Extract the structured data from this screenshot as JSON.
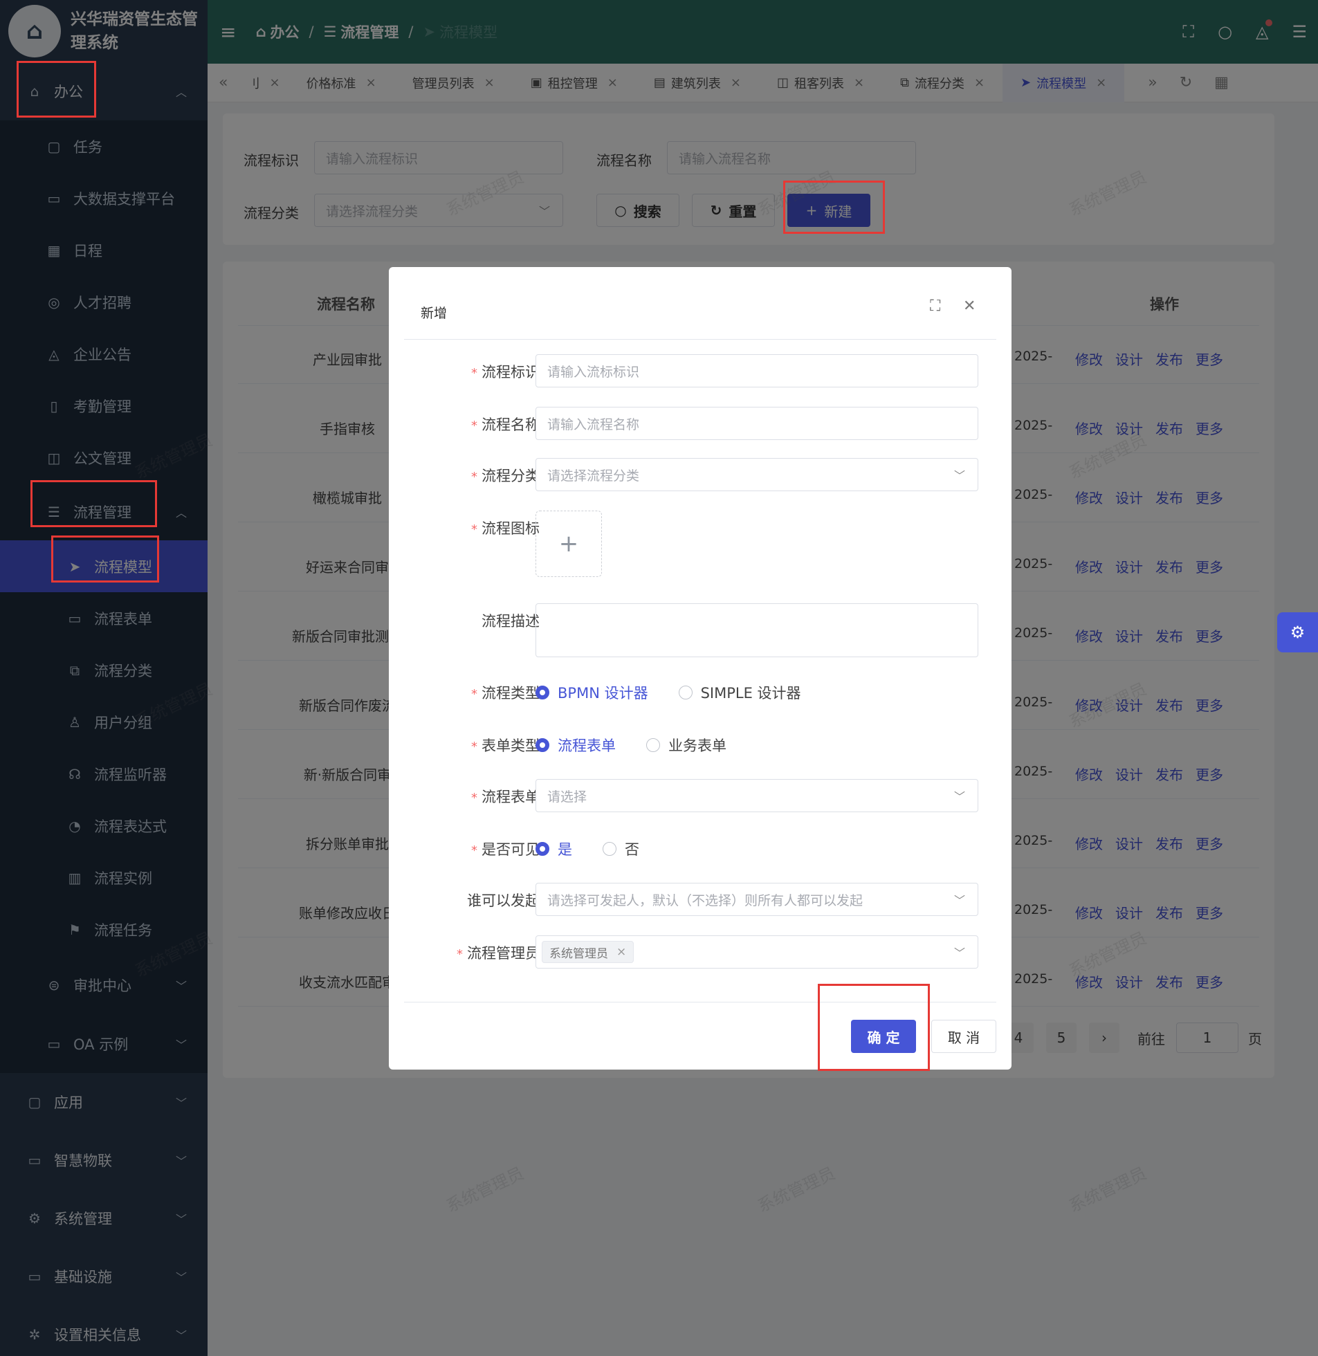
{
  "brand": {
    "title": "兴华瑞资管生态管理系统"
  },
  "sidebar": {
    "top": {
      "label": "办公"
    },
    "office_items": [
      "任务",
      "大数据支撑平台",
      "日程",
      "人才招聘",
      "企业公告",
      "考勤管理",
      "公文管理"
    ],
    "process_group": {
      "label": "流程管理"
    },
    "process_items": [
      "流程模型",
      "流程表单",
      "流程分类",
      "用户分组",
      "流程监听器",
      "流程表达式",
      "流程实例",
      "流程任务"
    ],
    "office_more": [
      "审批中心",
      "OA 示例"
    ],
    "root_items": [
      "应用",
      "智慧物联",
      "系统管理",
      "基础设施",
      "设置相关信息"
    ]
  },
  "header": {
    "breadcrumb": [
      "办公",
      "流程管理",
      "流程模型"
    ]
  },
  "tags": [
    "刂",
    "价格标准",
    "管理员列表",
    "租控管理",
    "建筑列表",
    "租客列表",
    "流程分类",
    "流程模型"
  ],
  "search": {
    "key_label": "流程标识",
    "key_placeholder": "请输入流程标识",
    "name_label": "流程名称",
    "name_placeholder": "请输入流程名称",
    "category_label": "流程分类",
    "category_placeholder": "请选择流程分类",
    "search_btn": "搜索",
    "reset_btn": "重置",
    "new_btn": "新建"
  },
  "table": {
    "col_name": "流程名称",
    "col_ops": "操作",
    "rows": [
      "产业园审批",
      "手指审核",
      "橄榄城审批",
      "好运来合同审",
      "新版合同审批测试",
      "新版合同作废流",
      "新·新版合同审",
      "拆分账单审批",
      "账单修改应收日",
      "收支流水匹配审"
    ],
    "date_text": "2025-",
    "ops": [
      "修改",
      "设计",
      "发布",
      "更多"
    ]
  },
  "pager": {
    "pages": [
      "4",
      "5"
    ],
    "goto_label": "前往",
    "goto_value": "1",
    "page_suffix": "页"
  },
  "watermark": "系统管理员",
  "dialog": {
    "title": "新增",
    "fields": {
      "key": {
        "label": "流程标识",
        "placeholder": "请输入流标标识"
      },
      "name": {
        "label": "流程名称",
        "placeholder": "请输入流程名称"
      },
      "category": {
        "label": "流程分类",
        "placeholder": "请选择流程分类"
      },
      "icon": {
        "label": "流程图标"
      },
      "desc": {
        "label": "流程描述"
      },
      "type": {
        "label": "流程类型",
        "options": [
          "BPMN 设计器",
          "SIMPLE 设计器"
        ]
      },
      "form_type": {
        "label": "表单类型",
        "options": [
          "流程表单",
          "业务表单"
        ]
      },
      "form": {
        "label": "流程表单",
        "placeholder": "请选择"
      },
      "visible": {
        "label": "是否可见",
        "options": [
          "是",
          "否"
        ]
      },
      "starter": {
        "label": "谁可以发起",
        "placeholder": "请选择可发起人，默认（不选择）则所有人都可以发起"
      },
      "manager": {
        "label": "流程管理员",
        "chip": "系统管理员"
      }
    },
    "confirm": "确 定",
    "cancel": "取 消"
  }
}
